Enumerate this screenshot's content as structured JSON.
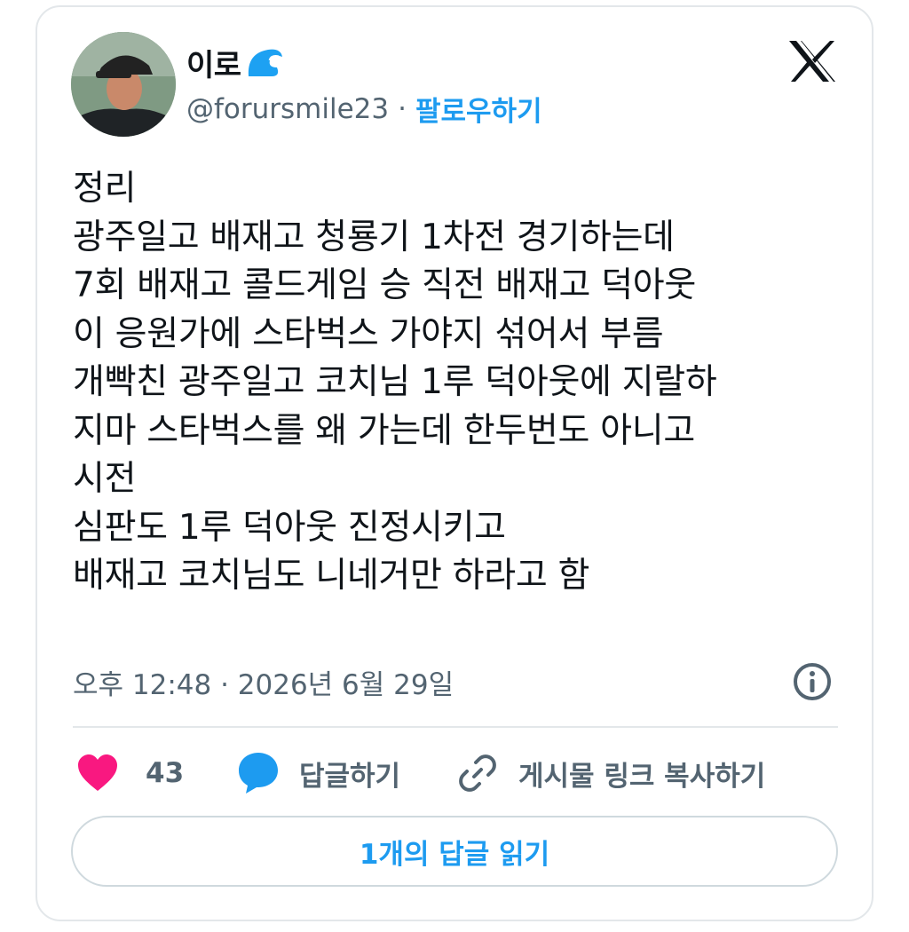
{
  "tweet": {
    "display_name": "이로",
    "handle": "@forursmile23",
    "separator": "·",
    "follow_label": "팔로우하기",
    "body_lines": [
      "정리",
      "광주일고 배재고 청룡기 1차전 경기하는데",
      "7회 배재고 콜드게임 승 직전 배재고 덕아웃",
      "이 응원가에 스타벅스 가야지 섞어서 부름",
      "개빡친 광주일고 코치님 1루 덕아웃에 지랄하",
      "지마 스타벅스를 왜 가는데 한두번도 아니고",
      "시전",
      "심판도 1루 덕아웃 진정시키고",
      "배재고 코치님도 니네거만 하라고 함"
    ],
    "timestamp": "오후 12:48 · 2026년 6월 29일"
  },
  "actions": {
    "like_count": "43",
    "reply_label": "답글하기",
    "copy_link_label": "게시물 링크 복사하기"
  },
  "read_replies_label": "1개의 답글 읽기",
  "icons": {
    "brand": "x-logo-icon",
    "emoji": "water-wave-icon",
    "info": "info-icon",
    "like": "heart-icon",
    "reply": "speech-bubble-icon",
    "link": "link-icon"
  },
  "colors": {
    "accent": "#1d9bf0",
    "like": "#f91880",
    "text": "#0f1419",
    "secondary": "#536471",
    "border": "#e3e7ea"
  }
}
